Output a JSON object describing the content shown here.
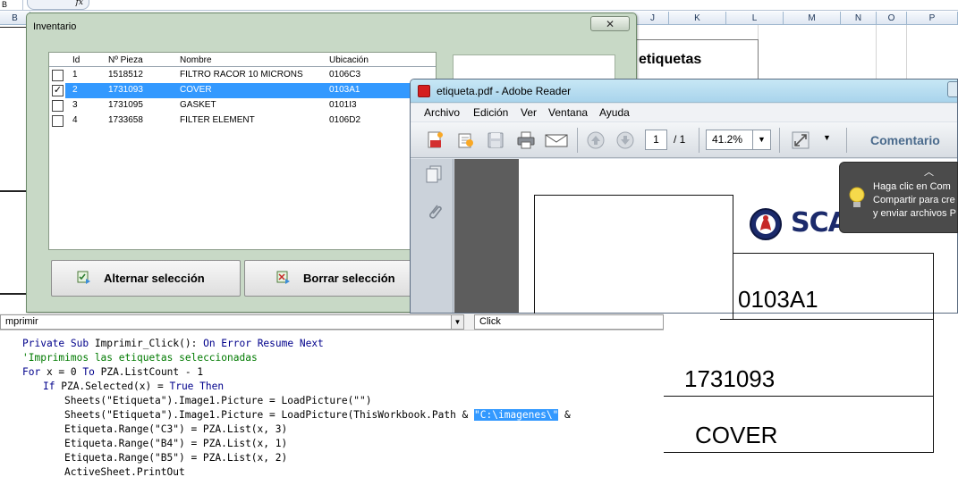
{
  "excel": {
    "name_box": "B",
    "fx_label": "fx",
    "columns": [
      "B",
      "J",
      "K",
      "L",
      "M",
      "N",
      "O",
      "P"
    ],
    "sheet_heading": "etiquetas"
  },
  "userform": {
    "title": "Inventario",
    "close_glyph": "✕",
    "columns": [
      "Id",
      "Nº Pieza",
      "Nombre",
      "Ubicación"
    ],
    "rows": [
      {
        "id": "1",
        "pieza": "1518512",
        "nombre": "FILTRO RACOR 10 MICRONS",
        "ubicacion": "0106C3",
        "checked": false,
        "selected": false
      },
      {
        "id": "2",
        "pieza": "1731093",
        "nombre": "COVER",
        "ubicacion": "0103A1",
        "checked": true,
        "selected": true
      },
      {
        "id": "3",
        "pieza": "1731095",
        "nombre": "GASKET",
        "ubicacion": "0101I3",
        "checked": false,
        "selected": false
      },
      {
        "id": "4",
        "pieza": "1733658",
        "nombre": "FILTER ELEMENT",
        "ubicacion": "0106D2",
        "checked": false,
        "selected": false
      }
    ],
    "check_glyph": "✓",
    "buttons": {
      "alternar": "Alternar selección",
      "borrar": "Borrar selección"
    }
  },
  "reader": {
    "title": "etiqueta.pdf - Adobe Reader",
    "menu": [
      "Archivo",
      "Edición",
      "Ver",
      "Ventana",
      "Ayuda"
    ],
    "page_current": "1",
    "page_total": "/ 1",
    "zoom": "41.2%",
    "comment_label": "Comentario",
    "tooltip": {
      "line1": "Haga clic en Com",
      "line2": "Compartir para cre",
      "line3": "y enviar archivos P"
    },
    "label": {
      "brand": "SCANIA",
      "location": "0103A1",
      "part_number": "1731093",
      "name": "COVER"
    }
  },
  "vba": {
    "procedure_combo": "mprimir",
    "event_combo": "Click",
    "code": {
      "l1_kw1": "Private Sub ",
      "l1_t1": "Imprimir_Click(): ",
      "l1_kw2": "On Error Resume Next",
      "l2_comment": "'Imprimimos las etiquetas seleccionadas",
      "l3_kw1": "For ",
      "l3_t1": "x = 0 ",
      "l3_kw2": "To ",
      "l3_t2": "PZA.ListCount - 1",
      "l4_kw1": "If ",
      "l4_t1": "PZA.Selected(x) = ",
      "l4_kw2": "True Then",
      "l5": "Sheets(\"Etiqueta\").Image1.Picture = LoadPicture(\"\")",
      "l6_t1": "Sheets(\"Etiqueta\").Image1.Picture = LoadPicture(ThisWorkbook.Path & ",
      "l6_hl": "\"C:\\imagenes\\\"",
      "l6_t2": " &",
      "l7": "Etiqueta.Range(\"C3\") = PZA.List(x, 3)",
      "l8": "Etiqueta.Range(\"B4\") = PZA.List(x, 1)",
      "l9": "Etiqueta.Range(\"B5\") = PZA.List(x, 2)",
      "l10": "ActiveSheet.PrintOut"
    }
  }
}
